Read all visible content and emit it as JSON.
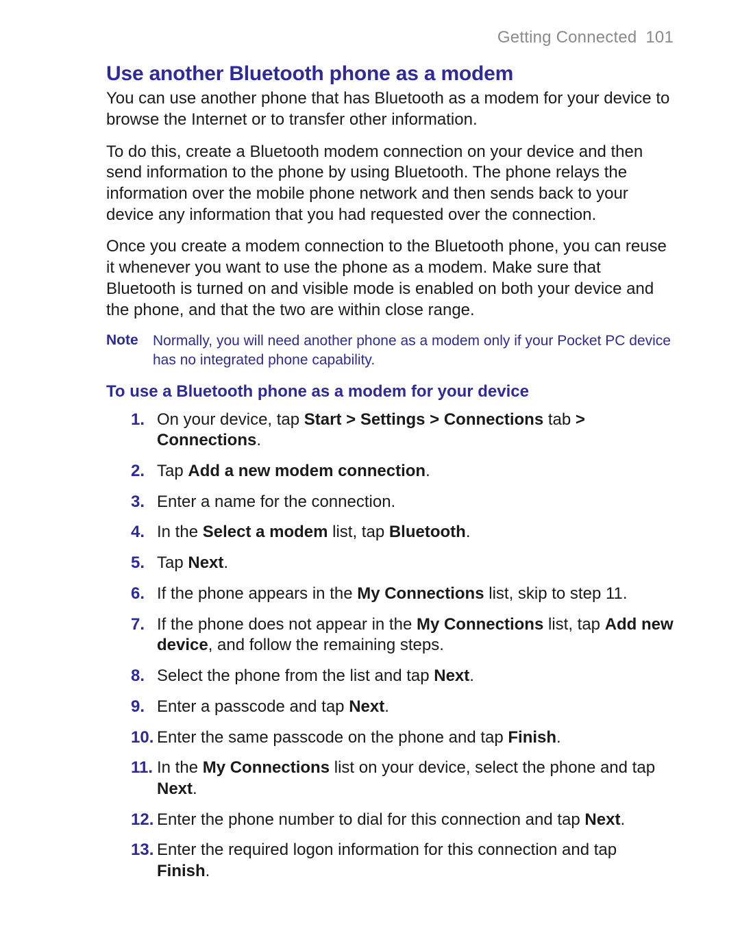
{
  "header": {
    "section": "Getting Connected",
    "page_number": "101"
  },
  "title": "Use another Bluetooth phone as a modem",
  "paragraphs": [
    "You can use another phone that has Bluetooth as a modem for your device to browse the Internet or to transfer other information.",
    "To do this, create a Bluetooth modem connection on your device and then send information to the phone by using Bluetooth. The phone relays the information over the mobile phone network and then sends back to your device any information that you had requested over the connection.",
    "Once you create a modem connection to the Bluetooth phone, you can reuse it whenever you want to use the phone as a modem. Make sure that Bluetooth is turned on and visible mode is enabled on both your device and the phone, and that the two are within close range."
  ],
  "note": {
    "label": "Note",
    "text": "Normally, you will need another phone as a modem only if your Pocket PC device has no integrated phone capability."
  },
  "subheading": "To use a Bluetooth phone as a modem for your device",
  "steps": [
    {
      "n": "1.",
      "html": "On your device, tap <b>Start > Settings > Connections</b> tab <b>> Connections</b>."
    },
    {
      "n": "2.",
      "html": "Tap <b>Add a new modem connection</b>."
    },
    {
      "n": "3.",
      "html": "Enter a name for the connection."
    },
    {
      "n": "4.",
      "html": "In the <b>Select a modem</b> list, tap <b>Bluetooth</b>."
    },
    {
      "n": "5.",
      "html": "Tap <b>Next</b>."
    },
    {
      "n": "6.",
      "html": "If the phone appears in the <b>My Connections</b> list, skip to step 11."
    },
    {
      "n": "7.",
      "html": "If the phone does not appear in the <b>My Connections</b> list, tap <b>Add new device</b>, and follow the remaining steps."
    },
    {
      "n": "8.",
      "html": "Select the phone from the list and tap <b>Next</b>."
    },
    {
      "n": "9.",
      "html": "Enter a passcode and tap <b>Next</b>."
    },
    {
      "n": "10.",
      "html": "Enter the same passcode on the phone and tap <b>Finish</b>."
    },
    {
      "n": "11.",
      "html": "In the <b>My Connections</b> list on your device, select the phone and tap <b>Next</b>."
    },
    {
      "n": "12.",
      "html": "Enter the phone number to dial for this connection and tap <b>Next</b>."
    },
    {
      "n": "13.",
      "html": "Enter the required logon information for this connection and tap <b>Finish</b>."
    }
  ]
}
